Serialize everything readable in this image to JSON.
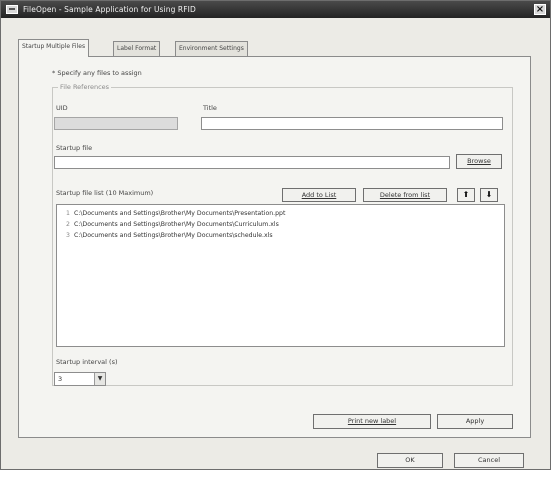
{
  "window": {
    "title": "FileOpen - Sample Application for Using RFID",
    "close_label": "×"
  },
  "tabs": [
    {
      "label": "Startup Multiple Files"
    },
    {
      "label": "Label Format"
    },
    {
      "label": "Environment Settings"
    }
  ],
  "form": {
    "instruction": "* Specify any files to assign",
    "group_label": "File References",
    "uid_label": "UID",
    "uid_value": "",
    "title_label": "Title",
    "title_value": "",
    "startup_file_label": "Startup file",
    "startup_file_value": "",
    "browse_label": "Browse",
    "file_list_label": "Startup file list (10 Maximum)",
    "add_to_list_label": "Add to List",
    "delete_from_list_label": "Delete from list",
    "move_up_label": "⬆",
    "move_down_label": "⬇",
    "file_list": [
      {
        "num": "1",
        "path": "C:\\Documents and Settings\\Brother\\My Documents\\Presentation.ppt"
      },
      {
        "num": "2",
        "path": "C:\\Documents and Settings\\Brother\\My Documents\\Curriculum.xls"
      },
      {
        "num": "3",
        "path": "C:\\Documents and Settings\\Brother\\My Documents\\schedule.xls"
      }
    ],
    "interval_label": "Startup interval (s)",
    "interval_value": "3",
    "interval_arrow": "▼",
    "print_label": "Print new label",
    "apply_label": "Apply"
  },
  "footer": {
    "ok_label": "OK",
    "cancel_label": "Cancel"
  }
}
